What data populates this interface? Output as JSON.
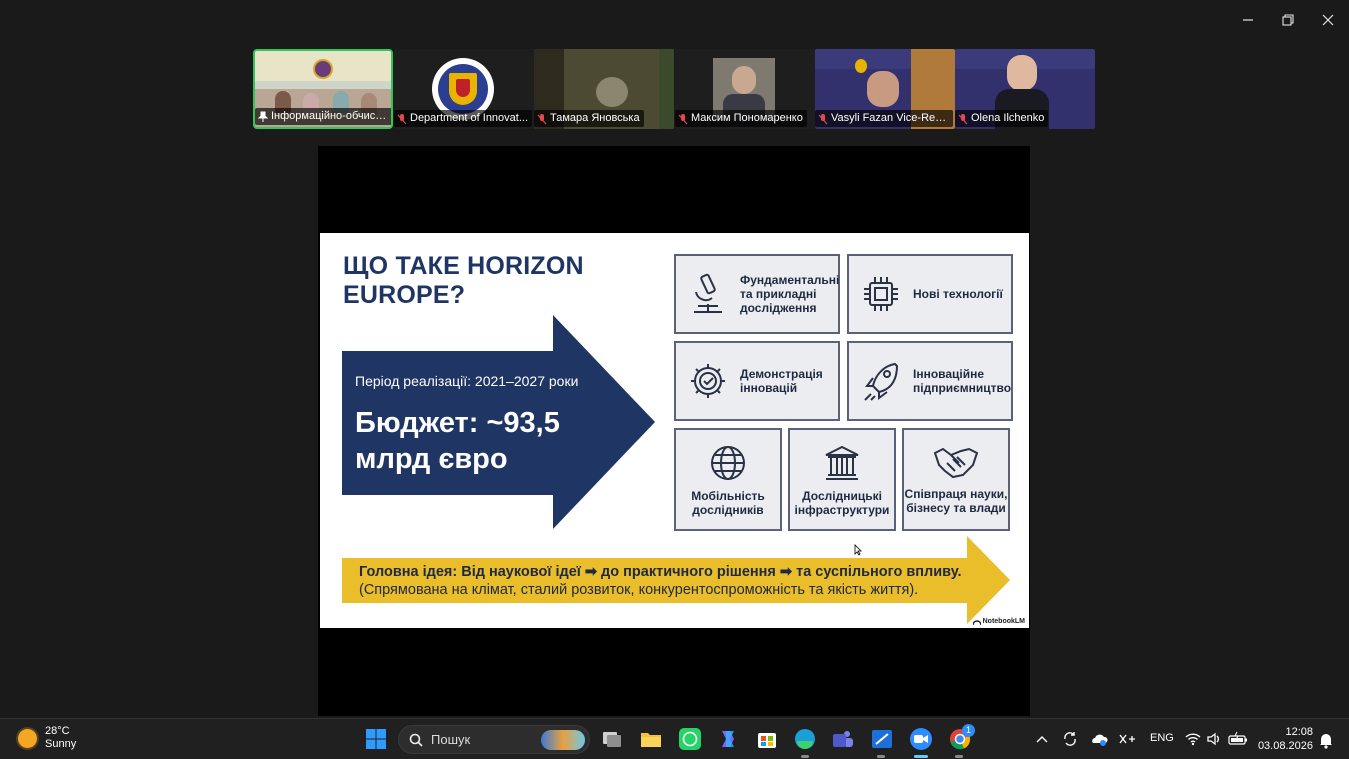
{
  "participants": [
    {
      "name": "Інформаційно-обчисл...",
      "pinned": true
    },
    {
      "name": "Department of Innovat..."
    },
    {
      "name": "Тамара Яновська"
    },
    {
      "name": "Максим Пономаренко"
    },
    {
      "name": "Vasyli Fazan Vice-Rect..."
    },
    {
      "name": "Olena Ilchenko"
    }
  ],
  "slide": {
    "title": "ЩО ТАКЕ HORIZON EUROPE?",
    "period": "Період реалізації: 2021–2027 роки",
    "budget": "Бюджет: ~93,5 млрд євро",
    "boxes": [
      {
        "label": "Фундаментальні та прикладні дослідження",
        "icon": "microscope-icon"
      },
      {
        "label": "Нові технології",
        "icon": "chip-icon"
      },
      {
        "label": "Демонстрація інновацій",
        "icon": "gear-check-icon"
      },
      {
        "label": "Інноваційне підприємництво",
        "icon": "rocket-icon"
      },
      {
        "label": "Мобільність дослідників",
        "icon": "globe-icon"
      },
      {
        "label": "Дослідницькі інфраструктури",
        "icon": "institution-icon"
      },
      {
        "label": "Співпраця науки, бізнесу та влади",
        "icon": "handshake-icon"
      }
    ],
    "idea_main": "Головна ідея: Від наукової ідеї ➡ до практичного рішення ➡ та суспільного впливу.",
    "idea_sub": "(Спрямована на клімат, сталий розвиток, конкурентоспроможність та якість життя).",
    "watermark": "NotebookLM",
    "colors": {
      "navy": "#1f3564",
      "yellow": "#eabd2a"
    }
  },
  "taskbar": {
    "temperature": "28°C",
    "condition": "Sunny",
    "search_placeholder": "Пошук",
    "language": "ENG",
    "time": "12:08",
    "date": "03.08.2026",
    "chrome_badge": "1"
  }
}
